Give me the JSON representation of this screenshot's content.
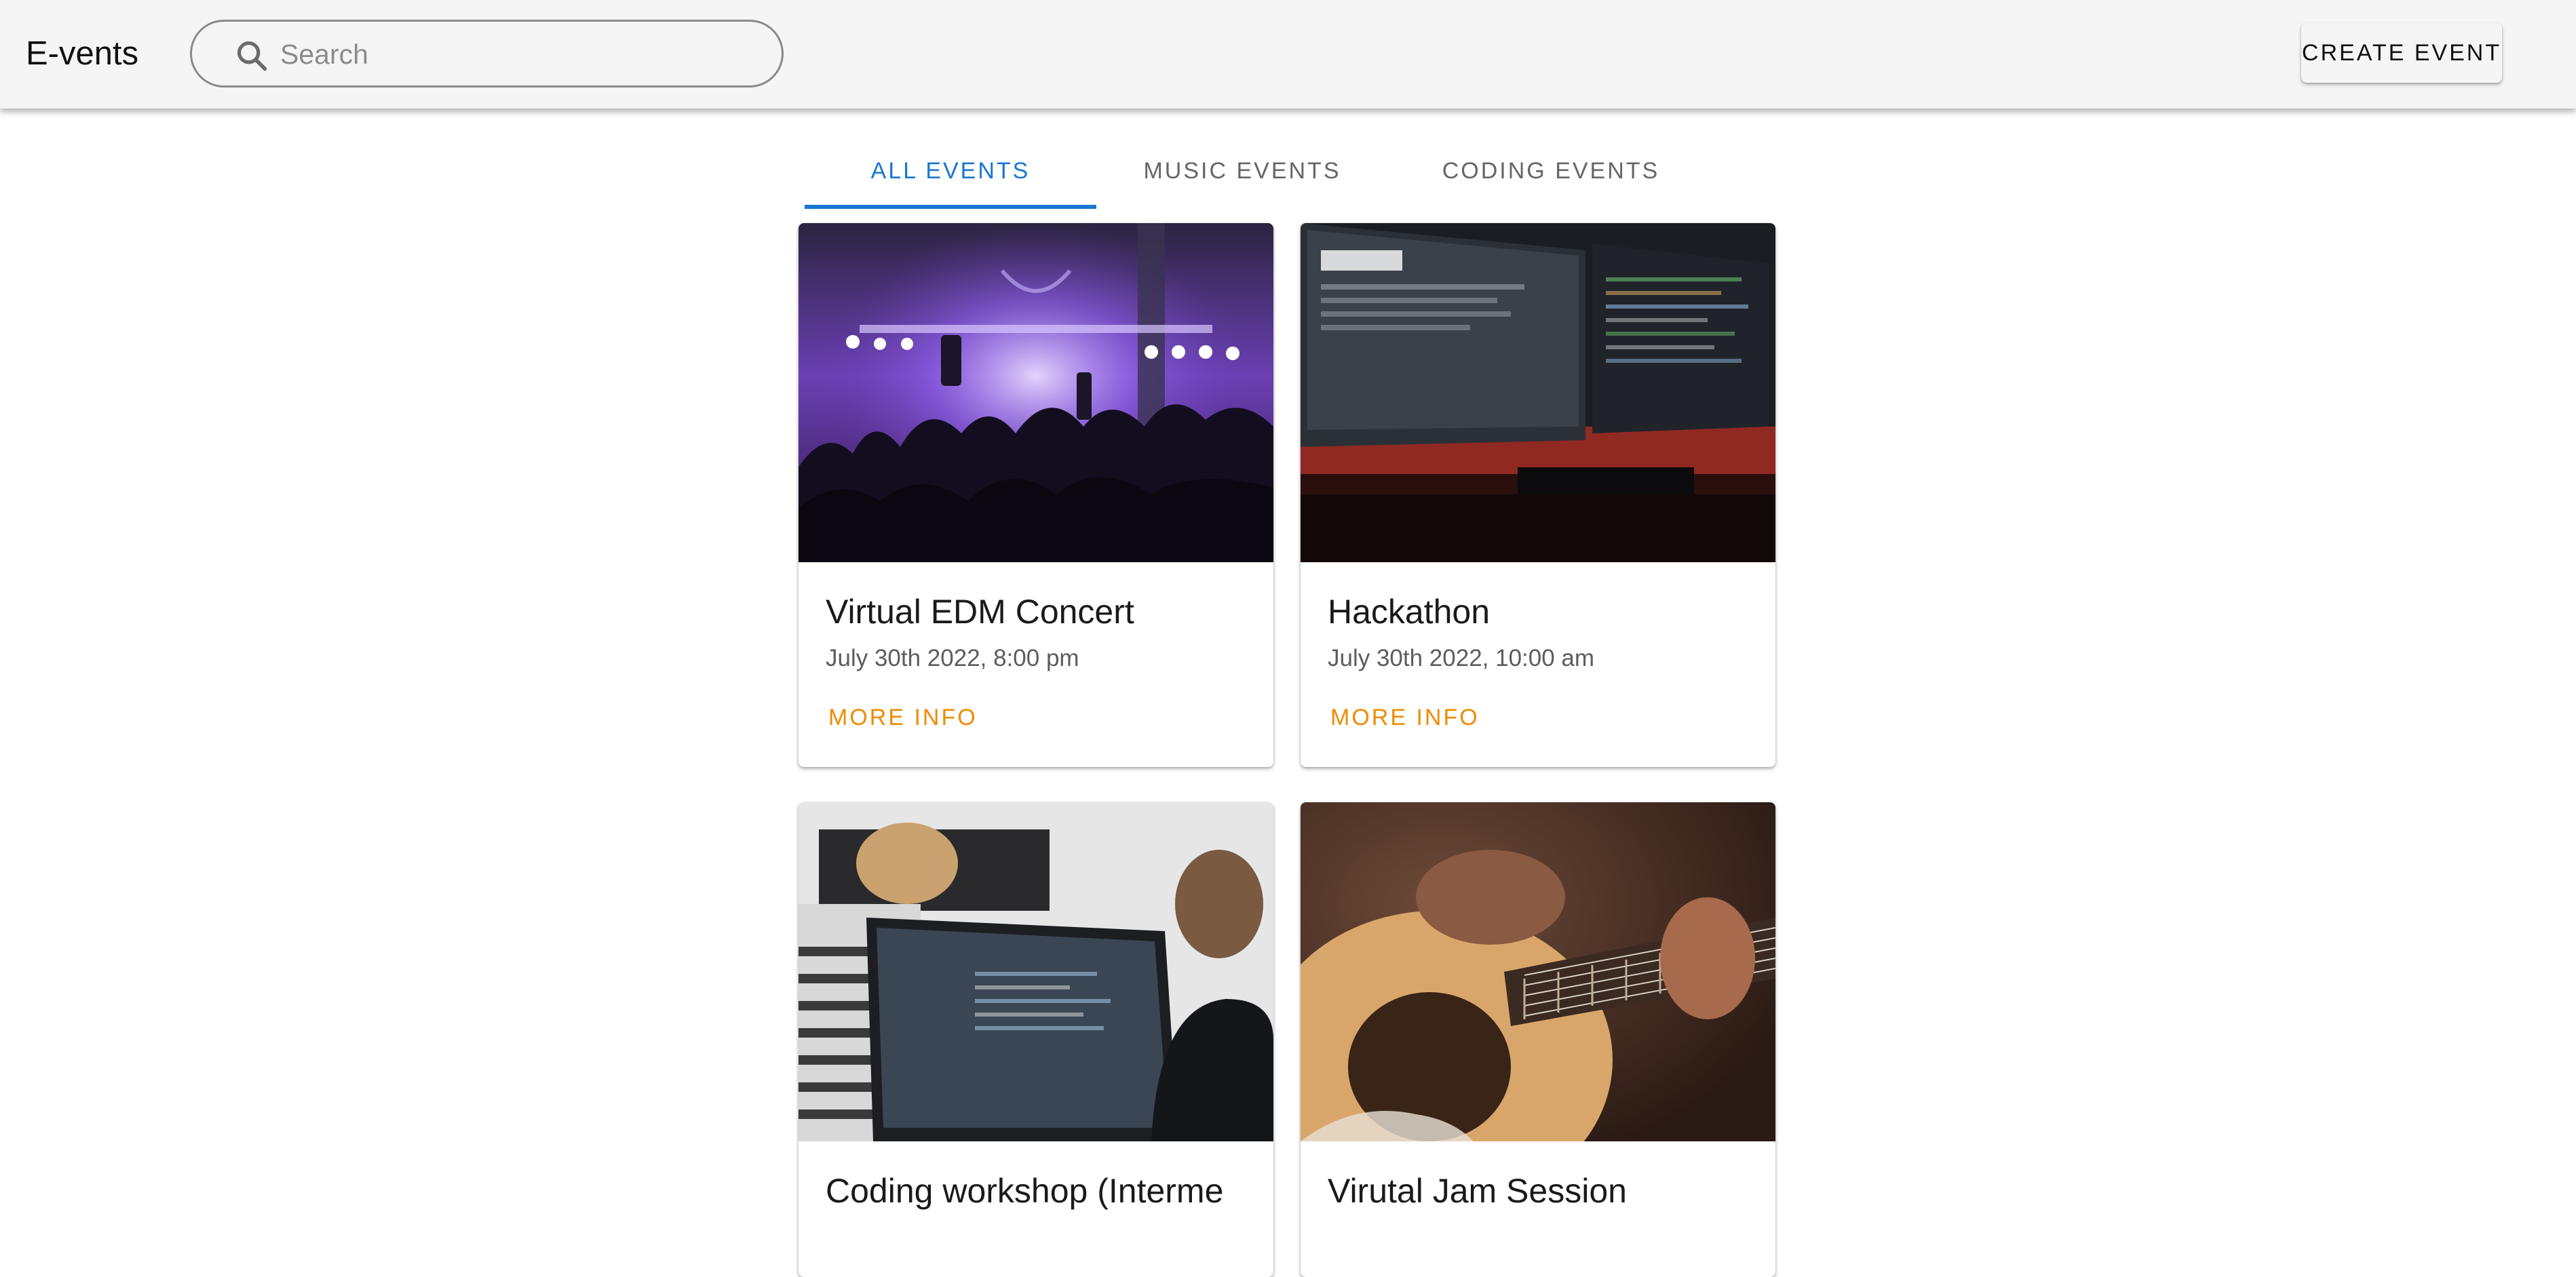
{
  "app": {
    "title": "E-vents"
  },
  "search": {
    "placeholder": "Search"
  },
  "header": {
    "create_label": "CREATE EVENT"
  },
  "tabs": [
    {
      "label": "ALL EVENTS",
      "active": true
    },
    {
      "label": "MUSIC EVENTS",
      "active": false
    },
    {
      "label": "CODING EVENTS",
      "active": false
    }
  ],
  "events": [
    {
      "title": "Virtual EDM Concert",
      "date": "July 30th 2022, 8:00 pm",
      "action": "MORE INFO",
      "image": "concert-crowd-photo"
    },
    {
      "title": "Hackathon",
      "date": "July 30th 2022, 10:00 am",
      "action": "MORE INFO",
      "image": "code-monitors-photo"
    },
    {
      "title": "Coding workshop (Interme",
      "date": "",
      "action": "",
      "image": "coding-workshop-photo"
    },
    {
      "title": "Virutal Jam Session",
      "date": "",
      "action": "",
      "image": "guitar-player-photo"
    }
  ],
  "colors": {
    "accent": "#1976d2",
    "action": "#ed8c00",
    "appbar": "#f5f5f5"
  }
}
